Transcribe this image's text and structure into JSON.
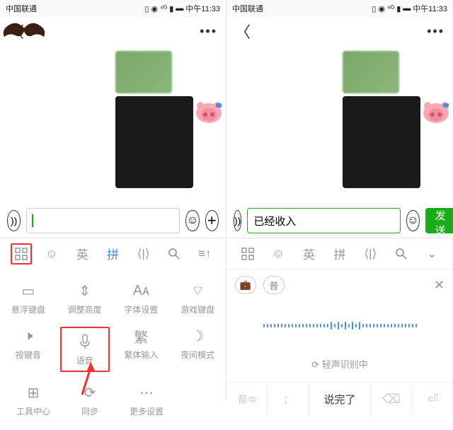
{
  "status": {
    "carrier": "中国联通",
    "time": "中午11:33"
  },
  "left": {
    "input_value": "",
    "toolbar": {
      "eng": "英",
      "pin": "拼"
    },
    "settings": {
      "row1": [
        "悬浮键盘",
        "调整高度",
        "字体设置",
        "游戏键盘"
      ],
      "row2": [
        "按键音",
        "语音",
        "繁体输入",
        "夜间模式"
      ],
      "row3": [
        "工具中心",
        "同步",
        "更多设置"
      ],
      "fan": "繁"
    }
  },
  "right": {
    "input_value": "已经收入",
    "send": "发送",
    "toolbar": {
      "eng": "英",
      "pin": "拼"
    },
    "voice": {
      "pu": "普",
      "recognizing": "轻声识别中",
      "yin": "音",
      "yin_sub": "/英",
      "semi": "；",
      "done": "说完了"
    }
  }
}
